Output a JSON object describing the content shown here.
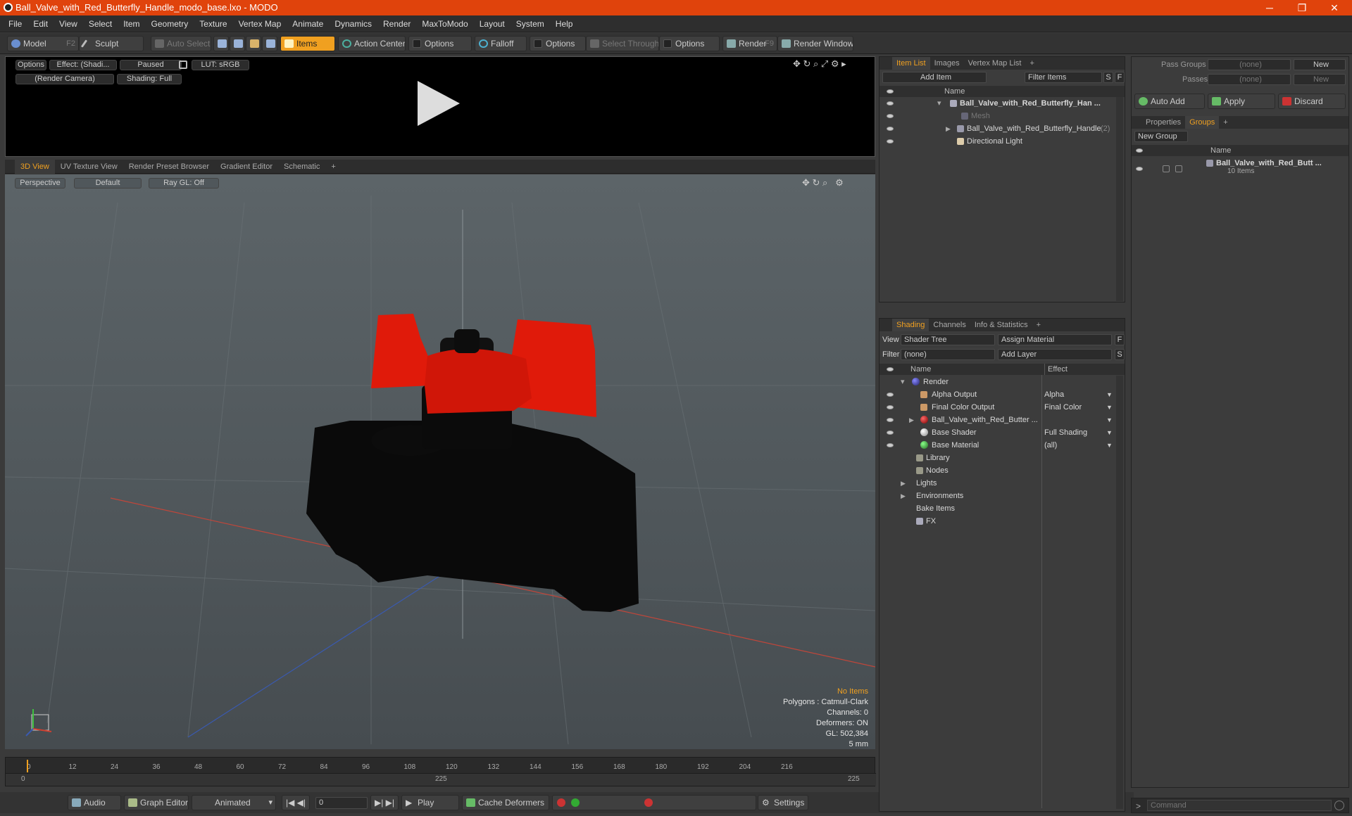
{
  "window": {
    "title": "Ball_Valve_with_Red_Butterfly_Handle_modo_base.lxo - MODO",
    "minimize": "─",
    "maximize": "❐",
    "close": "✕"
  },
  "menu": [
    "File",
    "Edit",
    "View",
    "Select",
    "Item",
    "Geometry",
    "Texture",
    "Vertex Map",
    "Animate",
    "Dynamics",
    "Render",
    "MaxToModo",
    "Layout",
    "System",
    "Help"
  ],
  "toolbar": {
    "model": "Model",
    "model_key": "F2",
    "sculpt": "Sculpt",
    "auto_select": "Auto Select",
    "items": "Items",
    "action_center": "Action Center",
    "options1": "Options",
    "falloff": "Falloff",
    "options2": "Options",
    "select_through": "Select Through",
    "options3": "Options",
    "render": "Render",
    "render_key": "F9",
    "render_window": "Render Window"
  },
  "preview": {
    "options": "Options",
    "effect": "Effect: (Shadi...",
    "paused": "Paused",
    "lut": "LUT: sRGB",
    "camera": "(Render Camera)",
    "shading": "Shading: Full"
  },
  "viewport_tabs": [
    "3D View",
    "UV Texture View",
    "Render Preset Browser",
    "Gradient Editor",
    "Schematic",
    "+"
  ],
  "viewport": {
    "perspective": "Perspective",
    "default": "Default",
    "raygl": "Ray GL: Off"
  },
  "stats": {
    "no_items": "No Items",
    "polygons": "Polygons : Catmull-Clark",
    "channels": "Channels: 0",
    "deformers": "Deformers: ON",
    "gl": "GL: 502,384",
    "scale": "5 mm"
  },
  "timeline": {
    "ticks": [
      "0",
      "12",
      "24",
      "36",
      "48",
      "60",
      "72",
      "84",
      "96",
      "108",
      "120",
      "132",
      "144",
      "156",
      "168",
      "180",
      "192",
      "204",
      "216"
    ],
    "start": "0",
    "mid": "225",
    "end": "225"
  },
  "bottom": {
    "audio": "Audio",
    "graph_editor": "Graph Editor",
    "animated": "Animated",
    "frame": "0",
    "play": "Play",
    "cache_deformers": "Cache Deformers",
    "settings": "Settings"
  },
  "item_list": {
    "tabs": [
      "Item List",
      "Images",
      "Vertex Map List",
      "+"
    ],
    "add_item": "Add Item",
    "filter_items": "Filter Items",
    "s": "S",
    "f": "F",
    "col_name": "Name",
    "rows": [
      "Ball_Valve_with_Red_Butterfly_Han ...",
      "Mesh",
      "Ball_Valve_with_Red_Butterfly_Handle",
      "Directional Light"
    ],
    "count": "(2)"
  },
  "shading": {
    "tabs": [
      "Shading",
      "Channels",
      "Info & Statistics",
      "+"
    ],
    "view_label": "View",
    "view_value": "Shader Tree",
    "assign_material": "Assign Material",
    "f": "F",
    "filter_label": "Filter",
    "filter_value": "(none)",
    "add_layer": "Add Layer",
    "s": "S",
    "col_name": "Name",
    "col_effect": "Effect",
    "rows": [
      {
        "name": "Render",
        "effect": ""
      },
      {
        "name": "Alpha Output",
        "effect": "Alpha"
      },
      {
        "name": "Final Color Output",
        "effect": "Final Color"
      },
      {
        "name": "Ball_Valve_with_Red_Butter ...",
        "effect": ""
      },
      {
        "name": "Base Shader",
        "effect": "Full Shading"
      },
      {
        "name": "Base Material",
        "effect": "(all)"
      },
      {
        "name": "Library",
        "effect": ""
      },
      {
        "name": "Nodes",
        "effect": ""
      },
      {
        "name": "Lights",
        "effect": ""
      },
      {
        "name": "Environments",
        "effect": ""
      },
      {
        "name": "Bake Items",
        "effect": ""
      },
      {
        "name": "FX",
        "effect": ""
      }
    ]
  },
  "groups": {
    "pass_groups": "Pass Groups",
    "pass_groups_value": "(none)",
    "new": "New",
    "passes": "Passes",
    "passes_value": "(none)",
    "new2": "New",
    "auto_add": "Auto Add",
    "apply": "Apply",
    "discard": "Discard",
    "tabs": [
      "Properties",
      "Groups",
      "+"
    ],
    "new_group": "New Group",
    "col_name": "Name",
    "item": "Ball_Valve_with_Red_Butt ...",
    "item_count": "10 Items"
  },
  "command": {
    "placeholder": "Command"
  },
  "colors": {
    "title": "#e0430c",
    "accent": "#f0a020",
    "handle": "#e01a0a"
  }
}
